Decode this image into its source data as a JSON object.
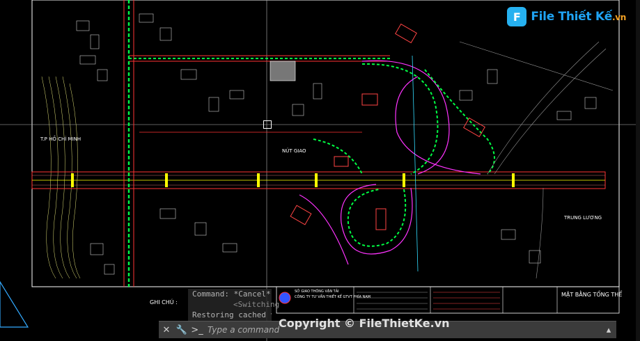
{
  "logo": {
    "text": "File Thiết Kế",
    "domain": ".vn",
    "mark": "F"
  },
  "drawing": {
    "label_left": "T.P HỒ CHÍ MINH",
    "label_right": "TRUNG LƯƠNG",
    "label_center": "NÚT GIAO",
    "notes_title": "GHI CHÚ :",
    "title_block": {
      "dept": "SỞ GIAO THÔNG VẬN TẢI",
      "company": "CÔNG TY TƯ VẤN THIẾT KẾ GTVT PHÍA NAM",
      "sheet_title": "MẶT BẰNG TỔNG THỂ"
    }
  },
  "command": {
    "history_1": "Command: *Cancel*",
    "history_2": "<Switching",
    "history_3": "Restoring cached v",
    "placeholder": "Type a command",
    "close_icon": "close-icon",
    "settings_icon": "wrench-icon"
  },
  "watermark": "Copyright © FileThietKe.vn",
  "colors": {
    "road": "#ff3333",
    "accent_green": "#00ff44",
    "accent_yellow": "#ffff00",
    "magenta": "#ff33ff",
    "cyan": "#33ddff"
  }
}
